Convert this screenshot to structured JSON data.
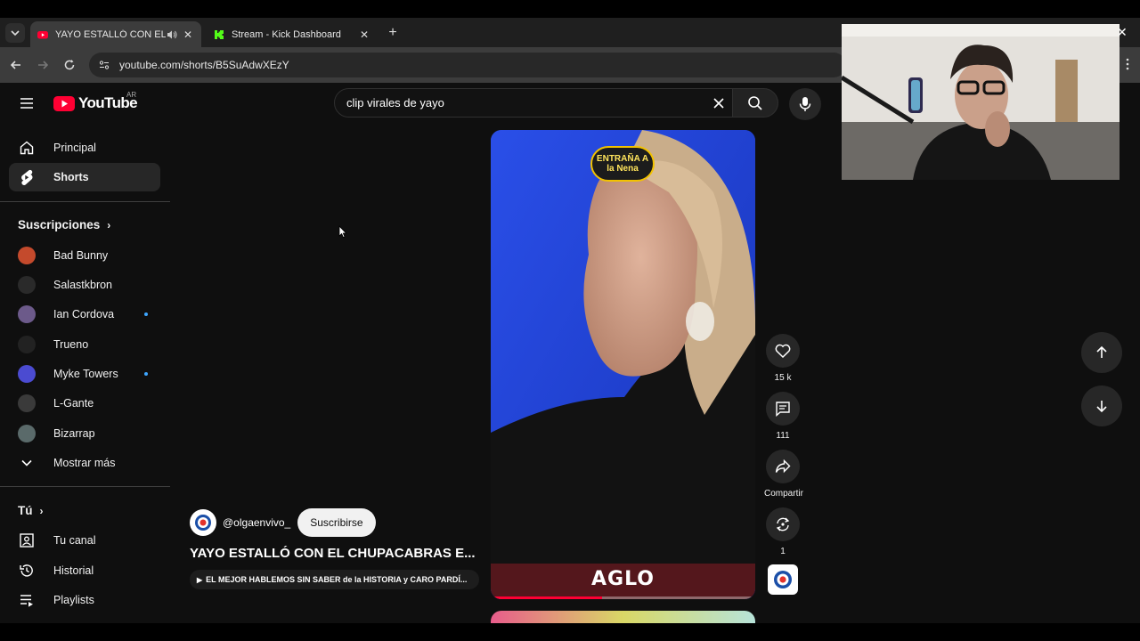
{
  "browser": {
    "tabs": [
      {
        "title": "YAYO ESTALLÓ CON EL CHUPACABRAS",
        "active": true
      },
      {
        "title": "Stream - Kick Dashboard",
        "active": false
      }
    ],
    "url": "youtube.com/shorts/B5SuAdwXEzY"
  },
  "youtube": {
    "logo_word": "YouTube",
    "country_code": "AR",
    "search_query": "clip virales de yayo"
  },
  "sidebar": {
    "primary": [
      {
        "label": "Principal",
        "icon": "home-icon"
      },
      {
        "label": "Shorts",
        "icon": "shorts-icon"
      }
    ],
    "subscriptions_heading": "Suscripciones",
    "subscriptions": [
      {
        "label": "Bad Bunny",
        "color": "#c44a2c",
        "new": false
      },
      {
        "label": "Salastkbron",
        "color": "#2a2a2a",
        "new": false
      },
      {
        "label": "Ian Cordova",
        "color": "#6c5a8a",
        "new": true
      },
      {
        "label": "Trueno",
        "color": "#222222",
        "new": false
      },
      {
        "label": "Myke Towers",
        "color": "#4b4bd1",
        "new": true
      },
      {
        "label": "L-Gante",
        "color": "#3a3a3a",
        "new": false
      },
      {
        "label": "Bizarrap",
        "color": "#5a6a6a",
        "new": false
      }
    ],
    "show_more": "Mostrar más",
    "you_heading": "Tú",
    "you_items": [
      {
        "label": "Tu canal",
        "icon": "channel-icon"
      },
      {
        "label": "Historial",
        "icon": "history-icon"
      },
      {
        "label": "Playlists",
        "icon": "playlists-icon"
      }
    ]
  },
  "short": {
    "channel_handle": "@olgaenvivo_",
    "subscribe_label": "Suscribirse",
    "title": "YAYO ESTALLÓ CON EL CHUPACABRAS E...",
    "playlist_label": "EL MEJOR HABLEMOS SIN SABER de la HISTORIA y CARO PARDÍ...",
    "overlay_logo_text": "ENTRAÑA A la Nena",
    "caption": "AGLO",
    "progress": 0.42
  },
  "actions": {
    "likes": "15 k",
    "comments": "111",
    "share": "Compartir",
    "remix": "1"
  }
}
